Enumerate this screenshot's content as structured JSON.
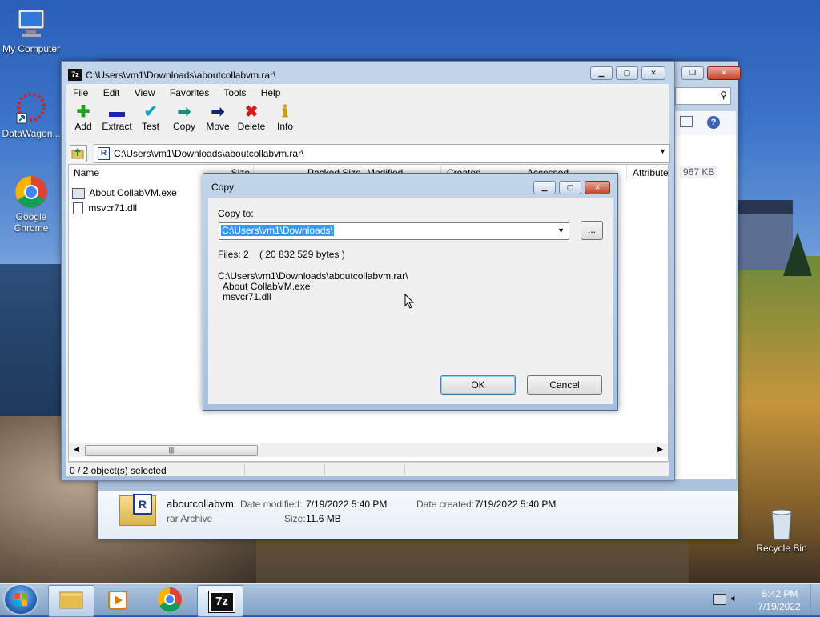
{
  "desktop": {
    "icons": [
      {
        "label": "My Computer"
      },
      {
        "label": "DataWagon..."
      },
      {
        "label": "Google Chrome"
      },
      {
        "label": "Recycle Bin"
      }
    ]
  },
  "explorer": {
    "details": {
      "name": "aboutcollabvm",
      "type": "rar Archive",
      "date_modified_label": "Date modified:",
      "date_modified": "7/19/2022 5:40 PM",
      "date_created_label": "Date created:",
      "date_created": "7/19/2022 5:40 PM",
      "size_label": "Size:",
      "size": "11.6 MB"
    },
    "size_fragment": "967 KB"
  },
  "sevenzip": {
    "title": "C:\\Users\\vm1\\Downloads\\aboutcollabvm.rar\\",
    "menu": [
      "File",
      "Edit",
      "View",
      "Favorites",
      "Tools",
      "Help"
    ],
    "toolbar": [
      {
        "label": "Add",
        "icon": "add-icon",
        "glyph": "✚",
        "color": "#1ea31e"
      },
      {
        "label": "Extract",
        "icon": "extract-icon",
        "glyph": "▬",
        "color": "#1b2a9a"
      },
      {
        "label": "Test",
        "icon": "test-icon",
        "glyph": "✔",
        "color": "#13a3c2"
      },
      {
        "label": "Copy",
        "icon": "copy-icon",
        "glyph": "➡",
        "color": "#1e8a7a"
      },
      {
        "label": "Move",
        "icon": "move-icon",
        "glyph": "➡",
        "color": "#15206e"
      },
      {
        "label": "Delete",
        "icon": "delete-icon",
        "glyph": "✖",
        "color": "#d0201a"
      },
      {
        "label": "Info",
        "icon": "info-icon",
        "glyph": "ℹ",
        "color": "#c9a000"
      }
    ],
    "address": "C:\\Users\\vm1\\Downloads\\aboutcollabvm.rar\\",
    "columns": [
      "Name",
      "Size",
      "Packed Size",
      "Modified",
      "Created",
      "Accessed",
      "Attributes"
    ],
    "files": [
      {
        "name": "About CollabVM.exe",
        "icon": "exe-file-icon"
      },
      {
        "name": "msvcr71.dll",
        "icon": "dll-file-icon"
      }
    ],
    "status": "0 / 2 object(s) selected"
  },
  "copy_dialog": {
    "title": "Copy",
    "copy_to_label": "Copy to:",
    "path_value": "C:\\Users\\vm1\\Downloads\\",
    "browse_label": "...",
    "files_info": "Files: 2    ( 20 832 529 bytes )",
    "source_path": "C:\\Users\\vm1\\Downloads\\aboutcollabvm.rar\\",
    "file_list": [
      "About CollabVM.exe",
      "msvcr71.dll"
    ],
    "ok_label": "OK",
    "cancel_label": "Cancel"
  },
  "taskbar": {
    "time": "5:42 PM",
    "date": "7/19/2022"
  }
}
